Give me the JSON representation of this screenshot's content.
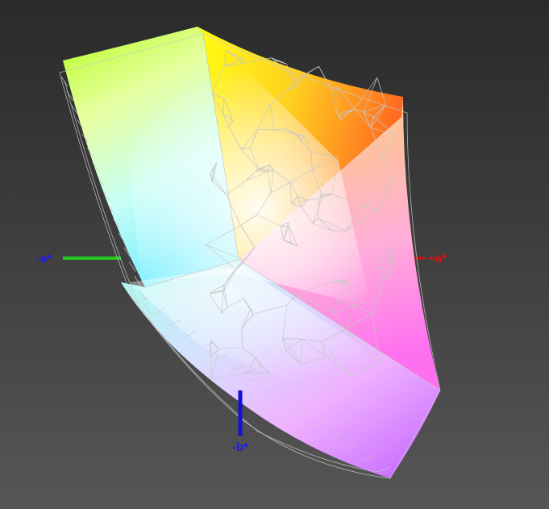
{
  "axes": {
    "neg_a": {
      "label": "-a*",
      "color": "#1a1aff",
      "line_color": "#22cc22"
    },
    "pos_a": {
      "label": "+a*",
      "color": "#e01010",
      "line_color": "#cc1111"
    },
    "neg_b": {
      "label": "-b*",
      "color": "#1a1aff",
      "line_color": "#1010dd"
    }
  },
  "wireframe_color": "#c8c8c8"
}
